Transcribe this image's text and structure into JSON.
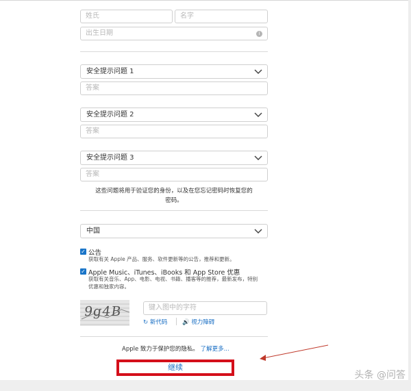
{
  "form": {
    "last_name_placeholder": "姓氏",
    "first_name_placeholder": "名字",
    "birthday_placeholder": "出生日期",
    "info_icon_glyph": "i",
    "questions": [
      {
        "label": "安全提示问题 1",
        "answer_placeholder": "答案"
      },
      {
        "label": "安全提示问题 2",
        "answer_placeholder": "答案"
      },
      {
        "label": "安全提示问题 3",
        "answer_placeholder": "答案"
      }
    ],
    "questions_note_line1": "这些问题将用于验证您的身份，以及在您忘记密码时恢复您的",
    "questions_note_line2": "密码。",
    "country": "中国",
    "announcements": {
      "checked": true,
      "title": "公告",
      "desc": "获取有关 Apple 产品、服务、软件更新等的公告，推荐和更新。"
    },
    "offers": {
      "checked": true,
      "title": "Apple Music、iTunes、iBooks 和 App Store 优惠",
      "desc_line1": "获取有关音乐、App、电影、电视、书籍、播客等的推荐，最新发布，特别",
      "desc_line2": "优惠和独家内容。"
    },
    "captcha": {
      "image_text": "9g4B",
      "input_placeholder": "键入图中的字符",
      "new_code_label": "新代码",
      "vision_label": "视力障碍"
    },
    "privacy_text": "Apple 致力于保护您的隐私。",
    "privacy_link": "了解更多...",
    "continue_label": "继续"
  },
  "watermark": "头条 @问答",
  "colors": {
    "accent_blue": "#1a6fc4",
    "checkbox_blue": "#1a75c8",
    "annotation_red": "#d40f1a"
  },
  "icons": [
    "info-icon",
    "chevron-down-icon",
    "checkbox-checked-icon",
    "refresh-icon",
    "speaker-icon",
    "annotation-arrow"
  ]
}
